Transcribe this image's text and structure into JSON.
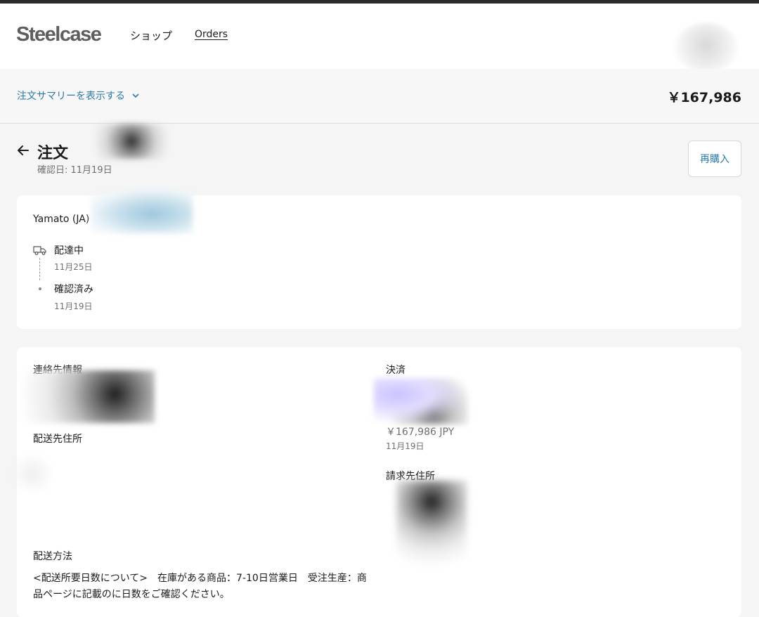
{
  "header": {
    "logo": "Steelcase",
    "nav": {
      "shop": "ショップ",
      "orders": "Orders"
    }
  },
  "summary": {
    "toggle_label": "注文サマリーを表示する",
    "total": "￥167,986"
  },
  "order": {
    "title": "注文",
    "confirmed_date": "確認日: 11月19日",
    "rebuy_label": "再購入"
  },
  "tracking": {
    "carrier": "Yamato (JA)",
    "steps": [
      {
        "label": "配達中",
        "date": "11月25日",
        "icon": "truck-icon"
      },
      {
        "label": "確認済み",
        "date": "11月19日",
        "icon": "dot-icon"
      }
    ]
  },
  "details": {
    "contact_title": "連絡先情報",
    "shipping_title": "配送先住所",
    "method_title": "配送方法",
    "method_text": "<配送所要日数について>　在庫がある商品：7-10日営業日　受注生産：商品ページに記載のに日数をご確認ください。",
    "payment_title": "決済",
    "payment_amount": "￥167,986 JPY",
    "payment_date": "11月19日",
    "billing_title": "請求先住所"
  },
  "colors": {
    "accent": "#2a7aa8",
    "text": "#1a1a1a",
    "muted": "#707070",
    "background": "#f5f5f5"
  }
}
